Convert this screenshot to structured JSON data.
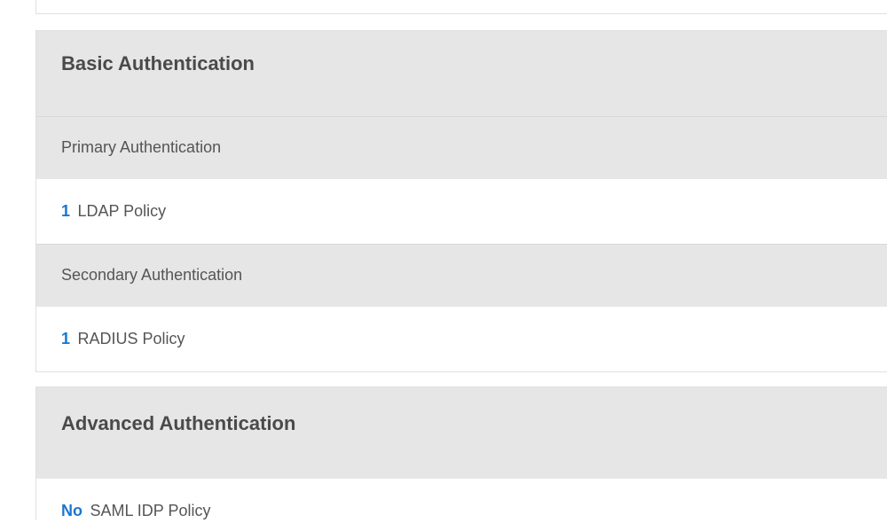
{
  "basicAuth": {
    "title": "Basic Authentication",
    "primary": {
      "header": "Primary Authentication",
      "count": "1",
      "label": "LDAP Policy"
    },
    "secondary": {
      "header": "Secondary Authentication",
      "count": "1",
      "label": "RADIUS Policy"
    }
  },
  "advancedAuth": {
    "title": "Advanced Authentication",
    "samlIdp": {
      "count": "No",
      "label": "SAML IDP Policy"
    }
  }
}
